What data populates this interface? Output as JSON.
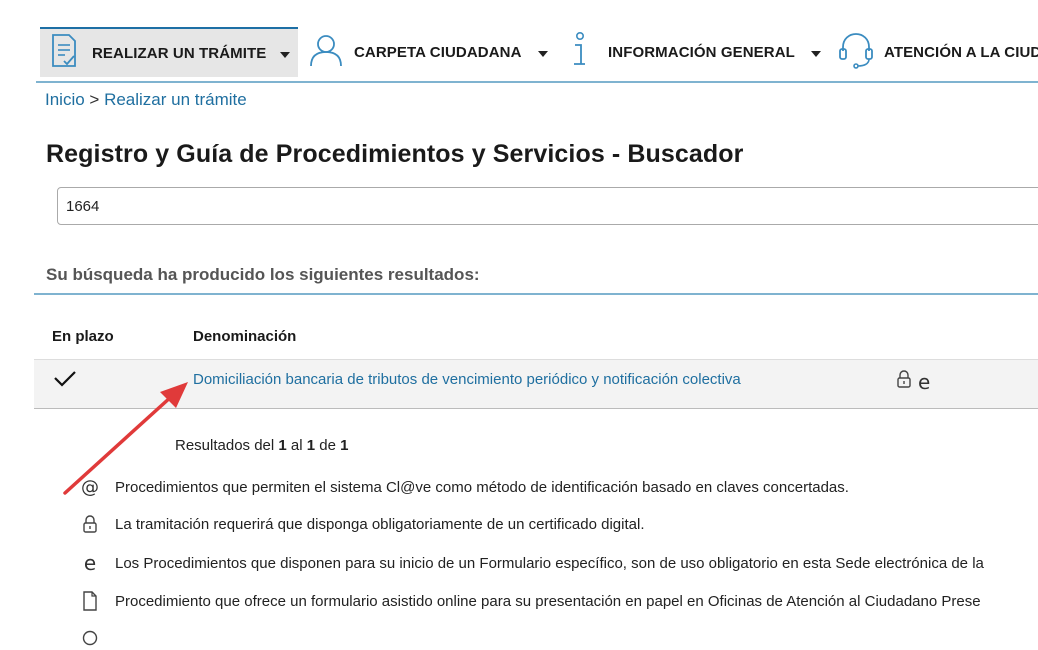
{
  "nav": {
    "items": [
      {
        "label": "REALIZAR UN TRÁMITE",
        "icon": "form-document-icon"
      },
      {
        "label": "CARPETA CIUDADANA",
        "icon": "user-icon"
      },
      {
        "label": "INFORMACIÓN GENERAL",
        "icon": "info-icon"
      },
      {
        "label": "ATENCIÓN A LA CIUDA",
        "icon": "headset-icon"
      }
    ]
  },
  "breadcrumb": {
    "home": "Inicio",
    "separator": " > ",
    "current": "Realizar un trámite"
  },
  "page": {
    "title": "Registro y Guía de Procedimientos y Servicios - Buscador"
  },
  "search": {
    "value": "1664"
  },
  "results": {
    "heading": "Su búsqueda ha producido los siguientes resultados:",
    "columns": [
      "En plazo",
      "Denominación"
    ],
    "rows": [
      {
        "in_time": "✓",
        "name": "Domiciliación bancaria de tributos de vencimiento periódico y notificación colectiva",
        "icons": [
          "lock-icon",
          "e-form-icon"
        ]
      }
    ],
    "pagination": {
      "prefix": "Resultados del ",
      "from": "1",
      "mid1": " al ",
      "to": "1",
      "mid2": " de ",
      "total": "1"
    }
  },
  "legend": [
    {
      "icon": "at-icon",
      "text": "Procedimientos que permiten el sistema Cl@ve como método de identificación basado en claves concertadas."
    },
    {
      "icon": "lock-icon",
      "text": "La tramitación requerirá que disponga obligatoriamente de un certificado digital."
    },
    {
      "icon": "e-form-icon",
      "text": "Los Procedimientos que disponen para su inicio de un Formulario específico, son de uso obligatorio en esta Sede electrónica de la"
    },
    {
      "icon": "paper-form-icon",
      "text": "Procedimiento que ofrece un formulario asistido online para su presentación en papel en Oficinas de Atención al Ciudadano Prese"
    }
  ],
  "colors": {
    "link": "#1f6fa0",
    "rule": "#7fb3d0",
    "annotation_arrow": "#e03a3a"
  }
}
